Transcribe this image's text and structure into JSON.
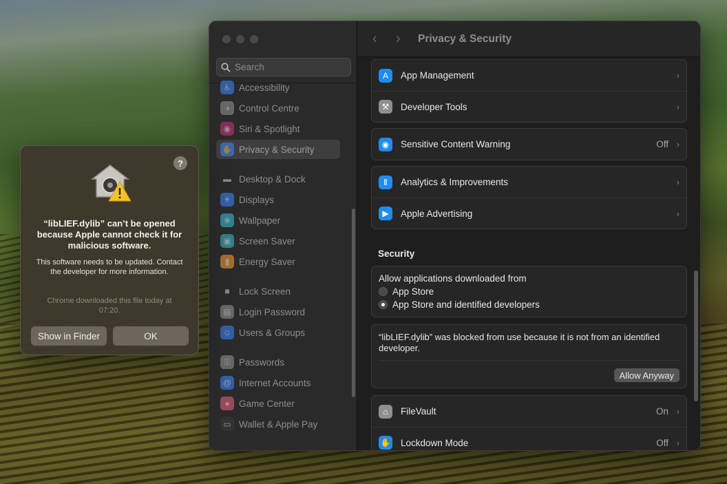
{
  "window": {
    "title": "Privacy & Security",
    "search_placeholder": "Search"
  },
  "sidebar": {
    "items": [
      {
        "label": "Accessibility",
        "icon": "accessibility-icon",
        "color": "#3c83f6"
      },
      {
        "label": "Control Centre",
        "icon": "control-centre-icon",
        "color": "#8e8e93"
      },
      {
        "label": "Siri & Spotlight",
        "icon": "siri-icon",
        "color": "#c2317a"
      },
      {
        "label": "Privacy & Security",
        "icon": "hand-icon",
        "color": "#3c83f6",
        "selected": true
      },
      {
        "label": "Desktop & Dock",
        "icon": "dock-icon",
        "color": "#2b2b2b"
      },
      {
        "label": "Displays",
        "icon": "displays-icon",
        "color": "#3c83f6"
      },
      {
        "label": "Wallpaper",
        "icon": "wallpaper-icon",
        "color": "#35b9d8"
      },
      {
        "label": "Screen Saver",
        "icon": "screen-saver-icon",
        "color": "#36b7c9"
      },
      {
        "label": "Energy Saver",
        "icon": "energy-saver-icon",
        "color": "#f09a37"
      },
      {
        "label": "Lock Screen",
        "icon": "lock-icon",
        "color": "#2b2b2b"
      },
      {
        "label": "Login Password",
        "icon": "login-password-icon",
        "color": "#8e8e93"
      },
      {
        "label": "Users & Groups",
        "icon": "users-icon",
        "color": "#3c83f6"
      },
      {
        "label": "Passwords",
        "icon": "key-icon",
        "color": "#8e8e93"
      },
      {
        "label": "Internet Accounts",
        "icon": "at-icon",
        "color": "#3c83f6"
      },
      {
        "label": "Game Center",
        "icon": "game-center-icon",
        "color": "#e0607e"
      },
      {
        "label": "Wallet & Apple Pay",
        "icon": "wallet-icon",
        "color": "#3a3a3a"
      }
    ]
  },
  "main": {
    "group1": [
      {
        "label": "App Management",
        "icon": "app-store-icon",
        "color": "#1d8cf5"
      },
      {
        "label": "Developer Tools",
        "icon": "hammer-icon",
        "color": "#8e8e93"
      }
    ],
    "group2": [
      {
        "label": "Sensitive Content Warning",
        "value": "Off",
        "icon": "eye-icon",
        "color": "#1d8cf5"
      }
    ],
    "group3": [
      {
        "label": "Analytics & Improvements",
        "icon": "analytics-icon",
        "color": "#1d8cf5"
      },
      {
        "label": "Apple Advertising",
        "icon": "megaphone-icon",
        "color": "#1d8cf5"
      }
    ],
    "security": {
      "heading": "Security",
      "allow_label": "Allow applications downloaded from",
      "options": [
        "App Store",
        "App Store and identified developers"
      ],
      "blocked_message": "“libLIEF.dylib” was blocked from use because it is not from an identified developer.",
      "allow_button": "Allow Anyway"
    },
    "group4": [
      {
        "label": "FileVault",
        "value": "On",
        "icon": "filevault-icon",
        "color": "#8e8e93"
      },
      {
        "label": "Lockdown Mode",
        "value": "Off",
        "icon": "lockdown-hand-icon",
        "color": "#1d8cf5"
      }
    ]
  },
  "alert": {
    "title": "“libLIEF.dylib” can’t be opened because Apple cannot check it for malicious software.",
    "message": "This software needs to be updated. Contact the developer for more information.",
    "note": "Chrome downloaded this file today at 07:20.",
    "show_in_finder": "Show in Finder",
    "ok": "OK",
    "help": "?"
  }
}
